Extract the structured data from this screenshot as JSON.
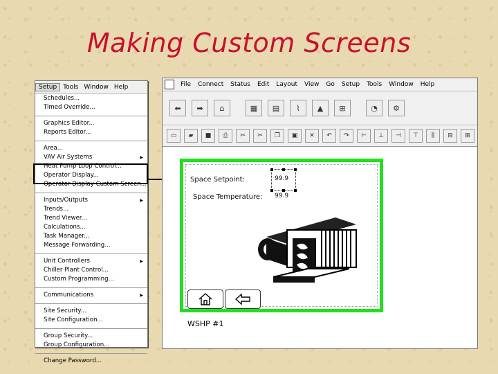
{
  "slide_title": "Making Custom Screens",
  "left_menubar": [
    "Setup",
    "Tools",
    "Window",
    "Help"
  ],
  "left_menu_groups": [
    [
      {
        "label": "Schedules..."
      },
      {
        "label": "Timed Override..."
      }
    ],
    [
      {
        "label": "Graphics Editor..."
      },
      {
        "label": "Reports Editor..."
      }
    ],
    [
      {
        "label": "Area..."
      },
      {
        "label": "VAV Air Systems",
        "arrow": true
      },
      {
        "label": "Heat Pump Loop Control..."
      },
      {
        "label": "Operator Display..."
      },
      {
        "label": "Operator Display Custom Screen..."
      }
    ],
    [
      {
        "label": "Inputs/Outputs",
        "arrow": true
      },
      {
        "label": "Trends..."
      },
      {
        "label": "Trend Viewer..."
      },
      {
        "label": "Calculations..."
      },
      {
        "label": "Task Manager..."
      },
      {
        "label": "Message Forwarding..."
      }
    ],
    [
      {
        "label": "Unit Controllers",
        "arrow": true
      },
      {
        "label": "Chiller Plant Control..."
      },
      {
        "label": "Custom Programming..."
      }
    ],
    [
      {
        "label": "Communications",
        "arrow": true
      }
    ],
    [
      {
        "label": "Site Security..."
      },
      {
        "label": "Site Configuration..."
      }
    ],
    [
      {
        "label": "Group Security..."
      },
      {
        "label": "Group Configuration..."
      }
    ],
    [
      {
        "label": "Change Password..."
      }
    ]
  ],
  "app_menubar": [
    "File",
    "Connect",
    "Status",
    "Edit",
    "Layout",
    "View",
    "Go",
    "Setup",
    "Tools",
    "Window",
    "Help"
  ],
  "screen": {
    "space_setpoint_label": "Space Setpoint:",
    "space_setpoint_value": "99.9",
    "space_temp_label": "Space Temperature:",
    "space_temp_value": "99.9",
    "caption": "WSHP #1"
  },
  "colors": {
    "title": "#c8102e",
    "frame": "#21e021"
  }
}
